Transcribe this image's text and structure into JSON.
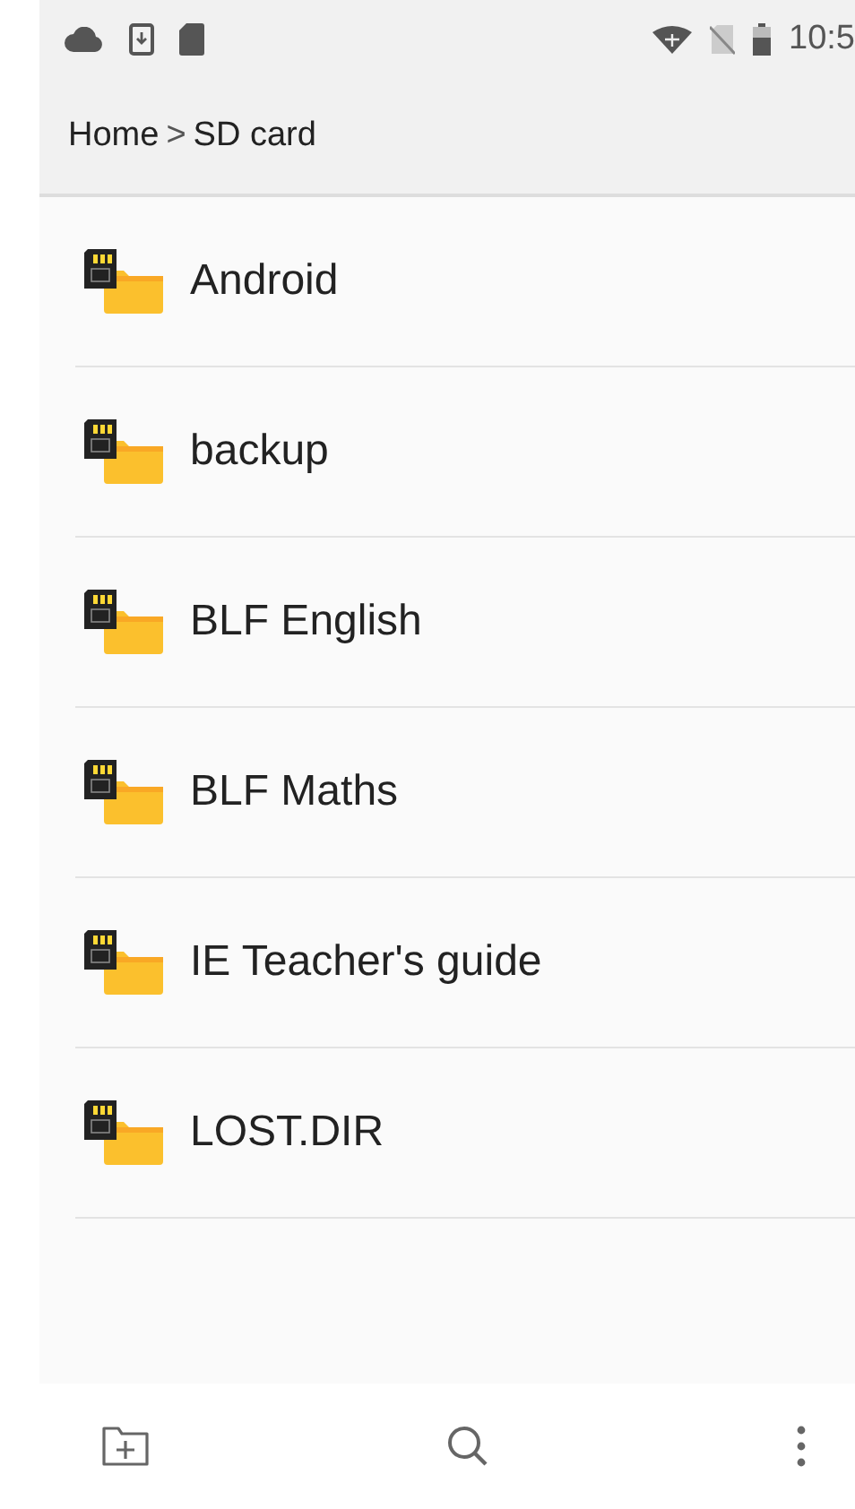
{
  "status_bar": {
    "time": "10:5"
  },
  "breadcrumb": [
    {
      "label": "Home"
    },
    {
      "label": "SD card"
    }
  ],
  "breadcrumb_separator": ">",
  "folders": [
    {
      "name": "Android"
    },
    {
      "name": "backup"
    },
    {
      "name": "BLF English"
    },
    {
      "name": "BLF Maths"
    },
    {
      "name": "IE Teacher's guide"
    },
    {
      "name": "LOST.DIR"
    }
  ]
}
